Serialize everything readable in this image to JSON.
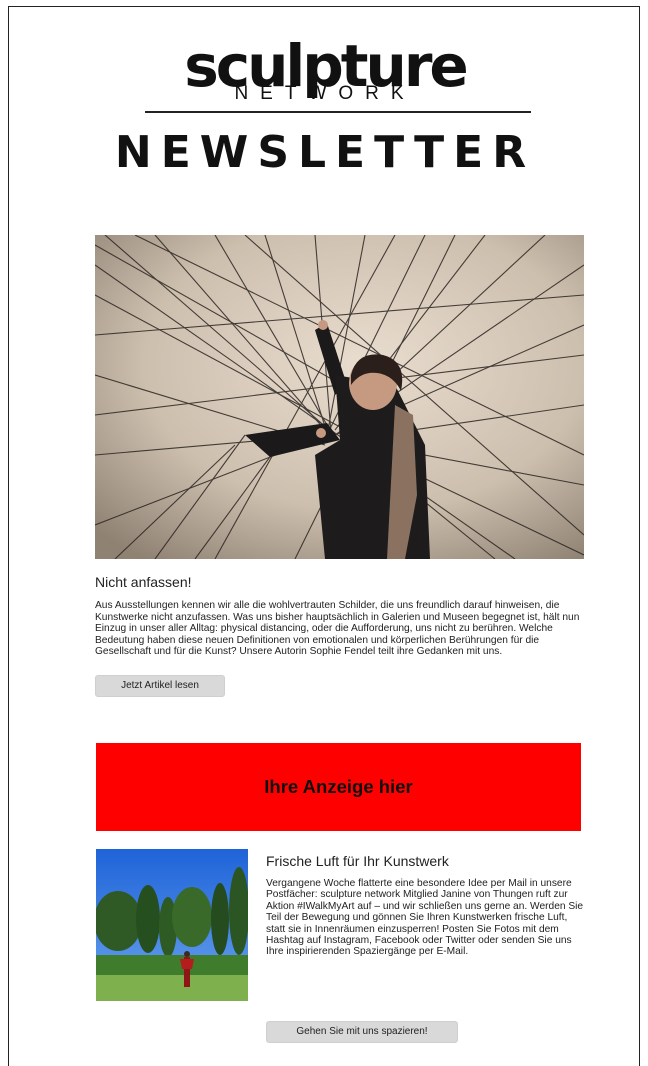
{
  "header": {
    "logo_word": "sculpture",
    "logo_sub": "NETWORK",
    "title": "NEWSLETTER"
  },
  "hero_image": {
    "icon": "sculpture-photo-icon"
  },
  "article": {
    "title": "Nicht anfassen!",
    "body": "Aus Ausstellungen kennen wir alle die wohlvertrauten Schilder, die uns freundlich darauf hinweisen, die Kunstwerke nicht anzufassen. Was uns bisher hauptsächlich in Galerien und Museen begegnet ist, hält nun Einzug in unser aller Alltag: physical distancing, oder die Aufforderung, uns nicht zu berühren. Welche Bedeutung haben diese neuen Definitionen von emotionalen und körperlichen Berührungen für die Gesellschaft und für die Kunst? Unsere Autorin Sophie Fendel teilt ihre Gedanken mit uns.",
    "button_label": "Jetzt Artikel lesen"
  },
  "ad": {
    "label": "Ihre Anzeige hier",
    "background": "#ff0000"
  },
  "second_article": {
    "title": "Frische Luft für Ihr Kunstwerk",
    "body": "Vergangene Woche flatterte eine besondere Idee per Mail in unsere Postfächer: sculpture network Mitglied Janine von Thungen ruft zur Aktion #IWalkMyArt auf – und wir schließen uns gerne an. Werden Sie Teil der Bewegung und gönnen Sie Ihren Kunstwerken frische Luft, statt sie in Innenräumen einzusperren! Posten Sie Fotos mit dem Hashtag auf Instagram, Facebook oder Twitter oder senden Sie uns Ihre inspirierenden Spaziergänge per E-Mail.",
    "button_label": "Gehen Sie mit uns spazieren!"
  }
}
